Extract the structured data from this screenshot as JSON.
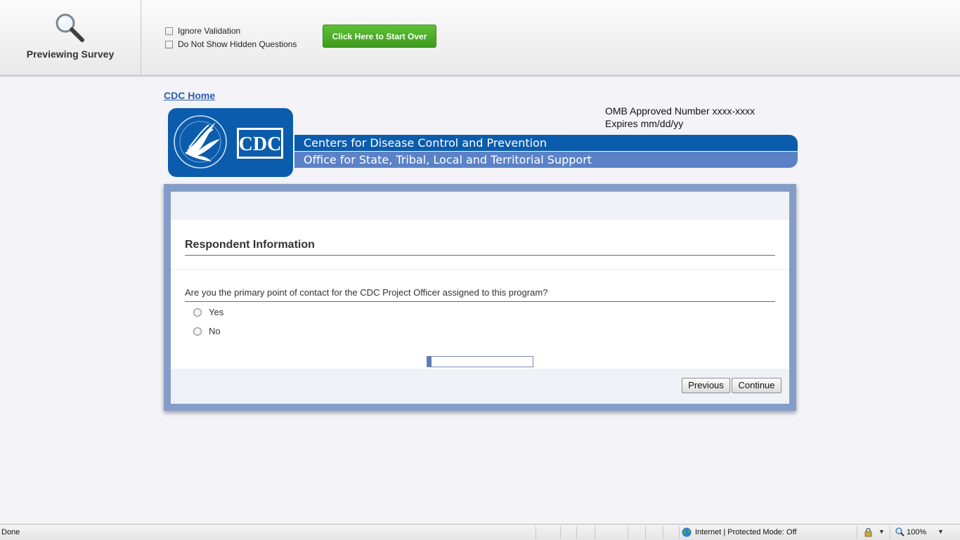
{
  "preview_bar": {
    "title": "Previewing Survey",
    "options": [
      {
        "label": "Ignore Validation",
        "checked": false
      },
      {
        "label": "Do Not Show Hidden Questions",
        "checked": false
      }
    ],
    "start_over_label": "Click Here to Start Over"
  },
  "header": {
    "home_link": "CDC Home",
    "omb_line1": "OMB Approved Number xxxx-xxxx",
    "omb_line2": "Expires mm/dd/yy",
    "logo_text": "CDC",
    "band1": "Centers for Disease Control and Prevention",
    "band2": "Office for State, Tribal, Local and Territorial Support"
  },
  "survey": {
    "section_title": "Respondent Information",
    "question": "Are you the primary point of contact for the CDC Project Officer assigned to this program?",
    "choices": [
      {
        "label": "Yes",
        "selected": false
      },
      {
        "label": "No",
        "selected": false
      }
    ],
    "progress_fraction": 0.04,
    "previous_label": "Previous",
    "continue_label": "Continue"
  },
  "status_bar": {
    "status": "Done",
    "zone": "Internet | Protected Mode: Off",
    "zoom": "100%"
  },
  "colors": {
    "band_dark": "#0b5cad",
    "band_light": "#5b82c6",
    "frame": "#849dc8",
    "start_over_green": "#4caf28"
  },
  "icons": [
    "magnifier-icon",
    "hhs-eagle-icon",
    "globe-icon",
    "lock-icon",
    "zoom-icon"
  ]
}
